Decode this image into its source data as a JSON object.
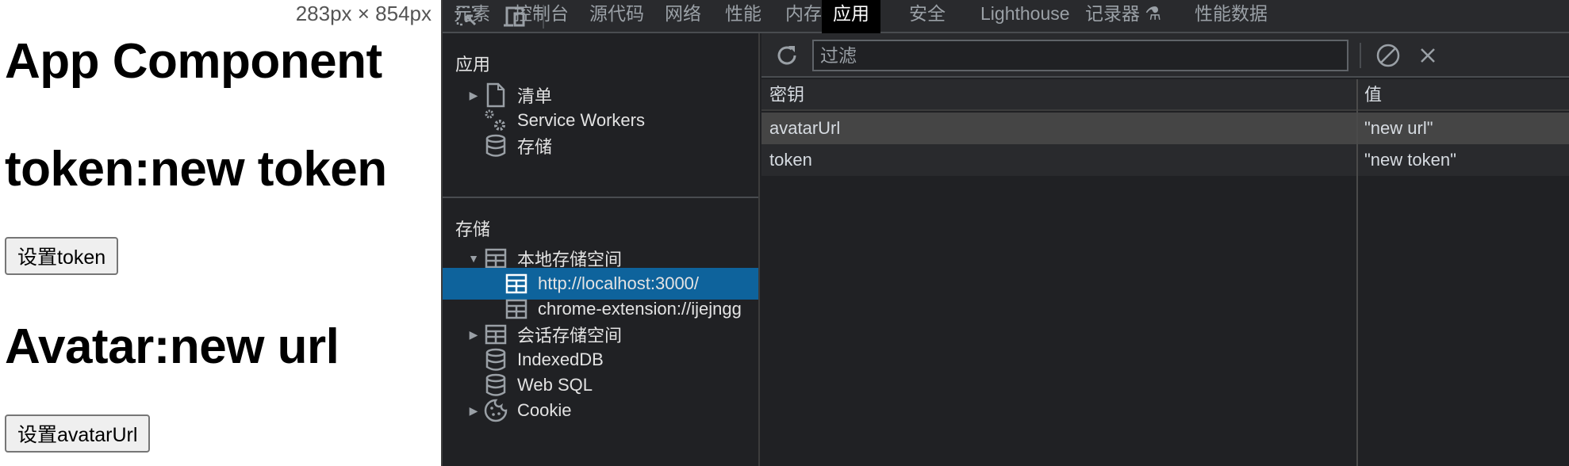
{
  "page": {
    "dimension_readout": "283px × 854px",
    "app_title": "App Component",
    "token_heading": "token:new token",
    "set_token_button": "设置token",
    "avatar_heading": "Avatar:new url",
    "set_avatar_button": "设置avatarUrl"
  },
  "devtools": {
    "toolbar_icons": [
      "inspect-element-icon",
      "device-toolbar-icon"
    ],
    "tabs": [
      {
        "label": "元素",
        "active": false
      },
      {
        "label": "控制台",
        "active": false
      },
      {
        "label": "源代码",
        "active": false
      },
      {
        "label": "网络",
        "active": false
      },
      {
        "label": "性能",
        "active": false
      },
      {
        "label": "内存",
        "active": false
      },
      {
        "label": "应用",
        "active": true
      },
      {
        "label": "安全",
        "active": false
      },
      {
        "label": "Lighthouse",
        "active": false
      },
      {
        "label": "记录器 ⚗",
        "active": false
      },
      {
        "label": "性能数据",
        "active": false
      }
    ],
    "sidebar": {
      "app_section_title": "应用",
      "app_items": [
        {
          "label": "清单",
          "icon": "file-icon",
          "expandable": true
        },
        {
          "label": "Service Workers",
          "icon": "gears-icon",
          "expandable": false
        },
        {
          "label": "存储",
          "icon": "database-icon",
          "expandable": false
        }
      ],
      "storage_section_title": "存储",
      "storage_items": [
        {
          "label": "本地存储空间",
          "icon": "table-icon",
          "expandable": true,
          "expanded": true
        },
        {
          "label": "http://localhost:3000/",
          "icon": "table-icon",
          "child": true,
          "selected": true
        },
        {
          "label": "chrome-extension://ijejngg",
          "icon": "table-icon",
          "child": true
        },
        {
          "label": "会话存储空间",
          "icon": "table-icon",
          "expandable": true
        },
        {
          "label": "IndexedDB",
          "icon": "database-icon"
        },
        {
          "label": "Web SQL",
          "icon": "database-icon"
        },
        {
          "label": "Cookie",
          "icon": "cookie-icon",
          "expandable": true
        }
      ]
    },
    "storage_view": {
      "filter_placeholder": "过滤",
      "filter_value": "",
      "columns": {
        "key": "密钥",
        "value": "值"
      },
      "rows": [
        {
          "key": "avatarUrl",
          "value": "\"new url\""
        },
        {
          "key": "token",
          "value": "\"new token\""
        }
      ]
    },
    "colors": {
      "selection": "#0e639c",
      "panel_bg": "#202124",
      "toolbar_bg": "#292a2d",
      "active_tab_bg": "#000000"
    }
  }
}
